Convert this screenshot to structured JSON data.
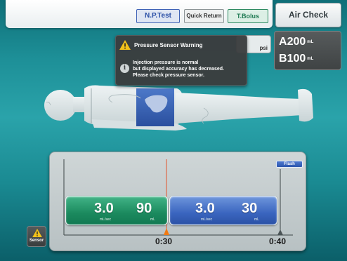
{
  "topbar": {
    "np_test": "N.P.Test",
    "quick_return": "Quick Return",
    "t_bolus": "T.Bolus"
  },
  "air_check": "Air Check",
  "volumes": {
    "a_label": "A",
    "a_value": "200",
    "a_unit": "mL",
    "b_label": "B",
    "b_value": "100",
    "b_unit": "mL"
  },
  "pressure": {
    "unit": "psi"
  },
  "warning": {
    "title": "Pressure Sensor Warning",
    "line1": "Injection pressure is normal",
    "line2": "but displayed accuracy has decreased.",
    "line3": "Please check pressure sensor."
  },
  "timeline": {
    "flash_label": "Flash",
    "phase_a": {
      "rate": "3.0",
      "rate_unit": "mL/sec",
      "volume": "90",
      "volume_unit": "mL",
      "color": "#1b8a5e"
    },
    "phase_b": {
      "rate": "3.0",
      "rate_unit": "mL/sec",
      "volume": "30",
      "volume_unit": "mL",
      "color": "#3a65bf"
    },
    "time_current": "0:30",
    "time_end": "0:40"
  },
  "sensor": {
    "label": "Sensor",
    "icon": "warning-icon"
  },
  "colors": {
    "warning_yellow": "#f2c21a",
    "marker_orange": "#f07a12",
    "background_teal": "#1d8f97"
  },
  "icons": [
    "warning-icon",
    "info-icon",
    "liver-icon",
    "time-marker-icon",
    "end-marker-icon"
  ]
}
